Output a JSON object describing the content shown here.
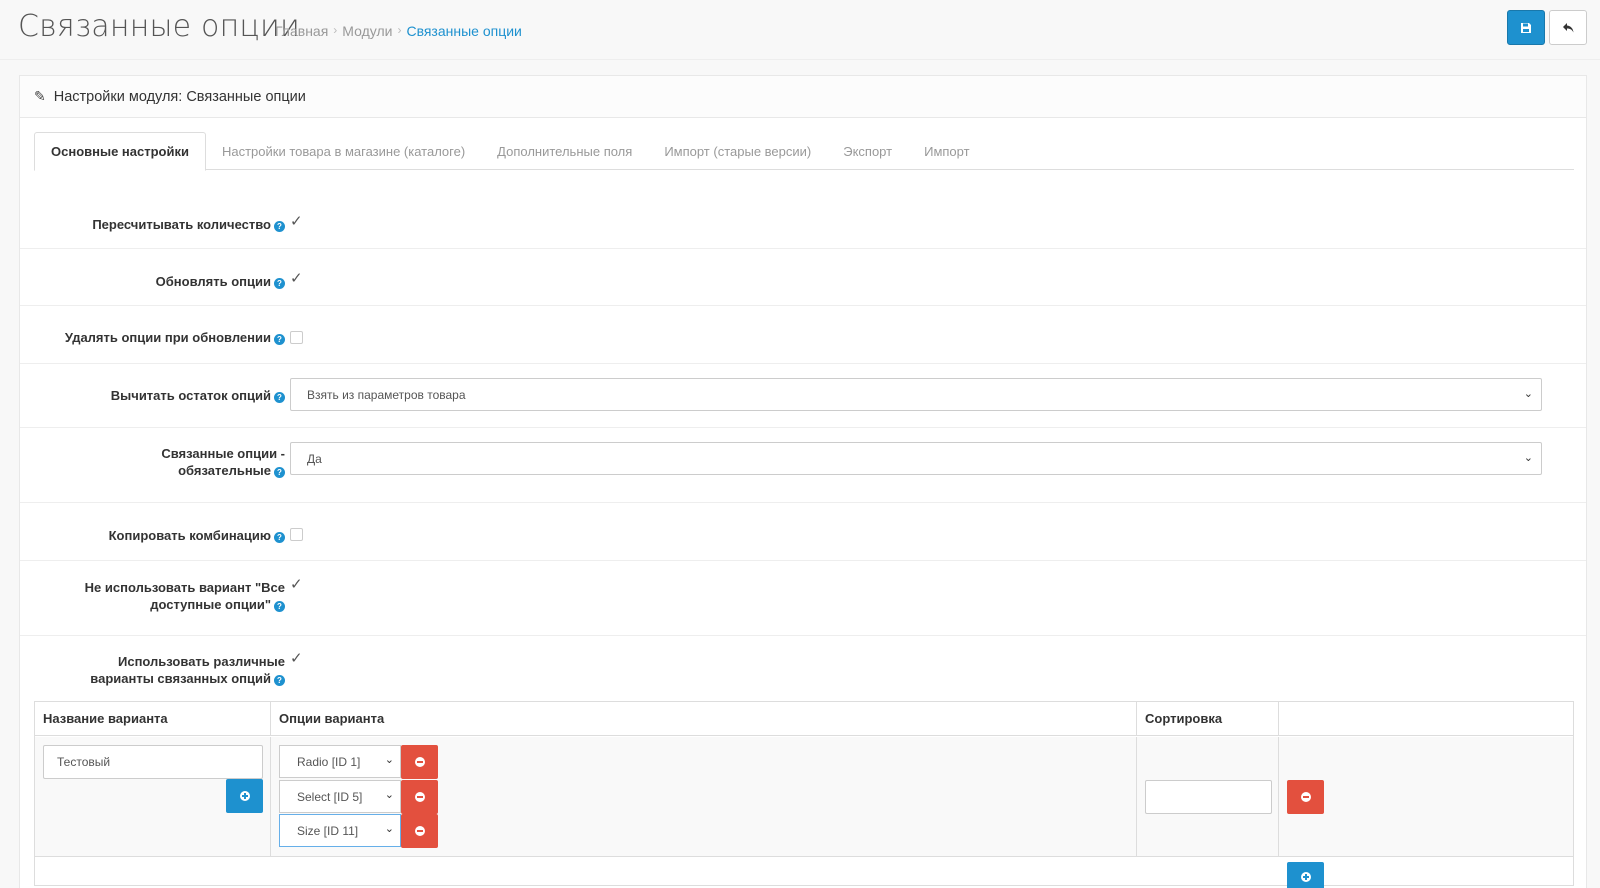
{
  "header": {
    "title": "Связанные опции",
    "breadcrumb": [
      "Главная",
      "Модули",
      "Связанные опции"
    ],
    "save_icon": "save-icon",
    "back_icon": "reply-icon"
  },
  "panel": {
    "title": "Настройки модуля: Связанные опции"
  },
  "tabs": [
    "Основные настройки",
    "Настройки товара в магазине (каталоге)",
    "Дополнительные поля",
    "Импорт (старые версии)",
    "Экспорт",
    "Импорт"
  ],
  "settings": {
    "recalc_qty": {
      "label": "Пересчитывать количество",
      "checked": true
    },
    "update_options": {
      "label": "Обновлять опции",
      "checked": true
    },
    "delete_options": {
      "label": "Удалять опции при обновлении",
      "checked": false
    },
    "subtract_stock": {
      "label": "Вычитать остаток опций",
      "value": "Взять из параметров товара"
    },
    "required_line1": "Связанные опции -",
    "required_line2": "обязательные",
    "required_value": "Да",
    "copy_combination": {
      "label": "Копировать комбинацию",
      "checked": false
    },
    "no_all_variant_line1": "Не использовать вариант \"Все",
    "no_all_variant_line2": "доступные опции\"",
    "use_variants_line1": "Использовать различные",
    "use_variants_line2": "варианты связанных опций"
  },
  "variants_table": {
    "columns": [
      "Название варианта",
      "Опции варианта",
      "Сортировка",
      ""
    ],
    "rows": [
      {
        "name": "Тестовый",
        "options": [
          "Radio   [ID 1]",
          "Select   [ID 5]",
          "Size   [ID 11]"
        ],
        "sort": ""
      }
    ]
  },
  "colors": {
    "primary": "#1e91cf",
    "danger": "#e3503e"
  }
}
